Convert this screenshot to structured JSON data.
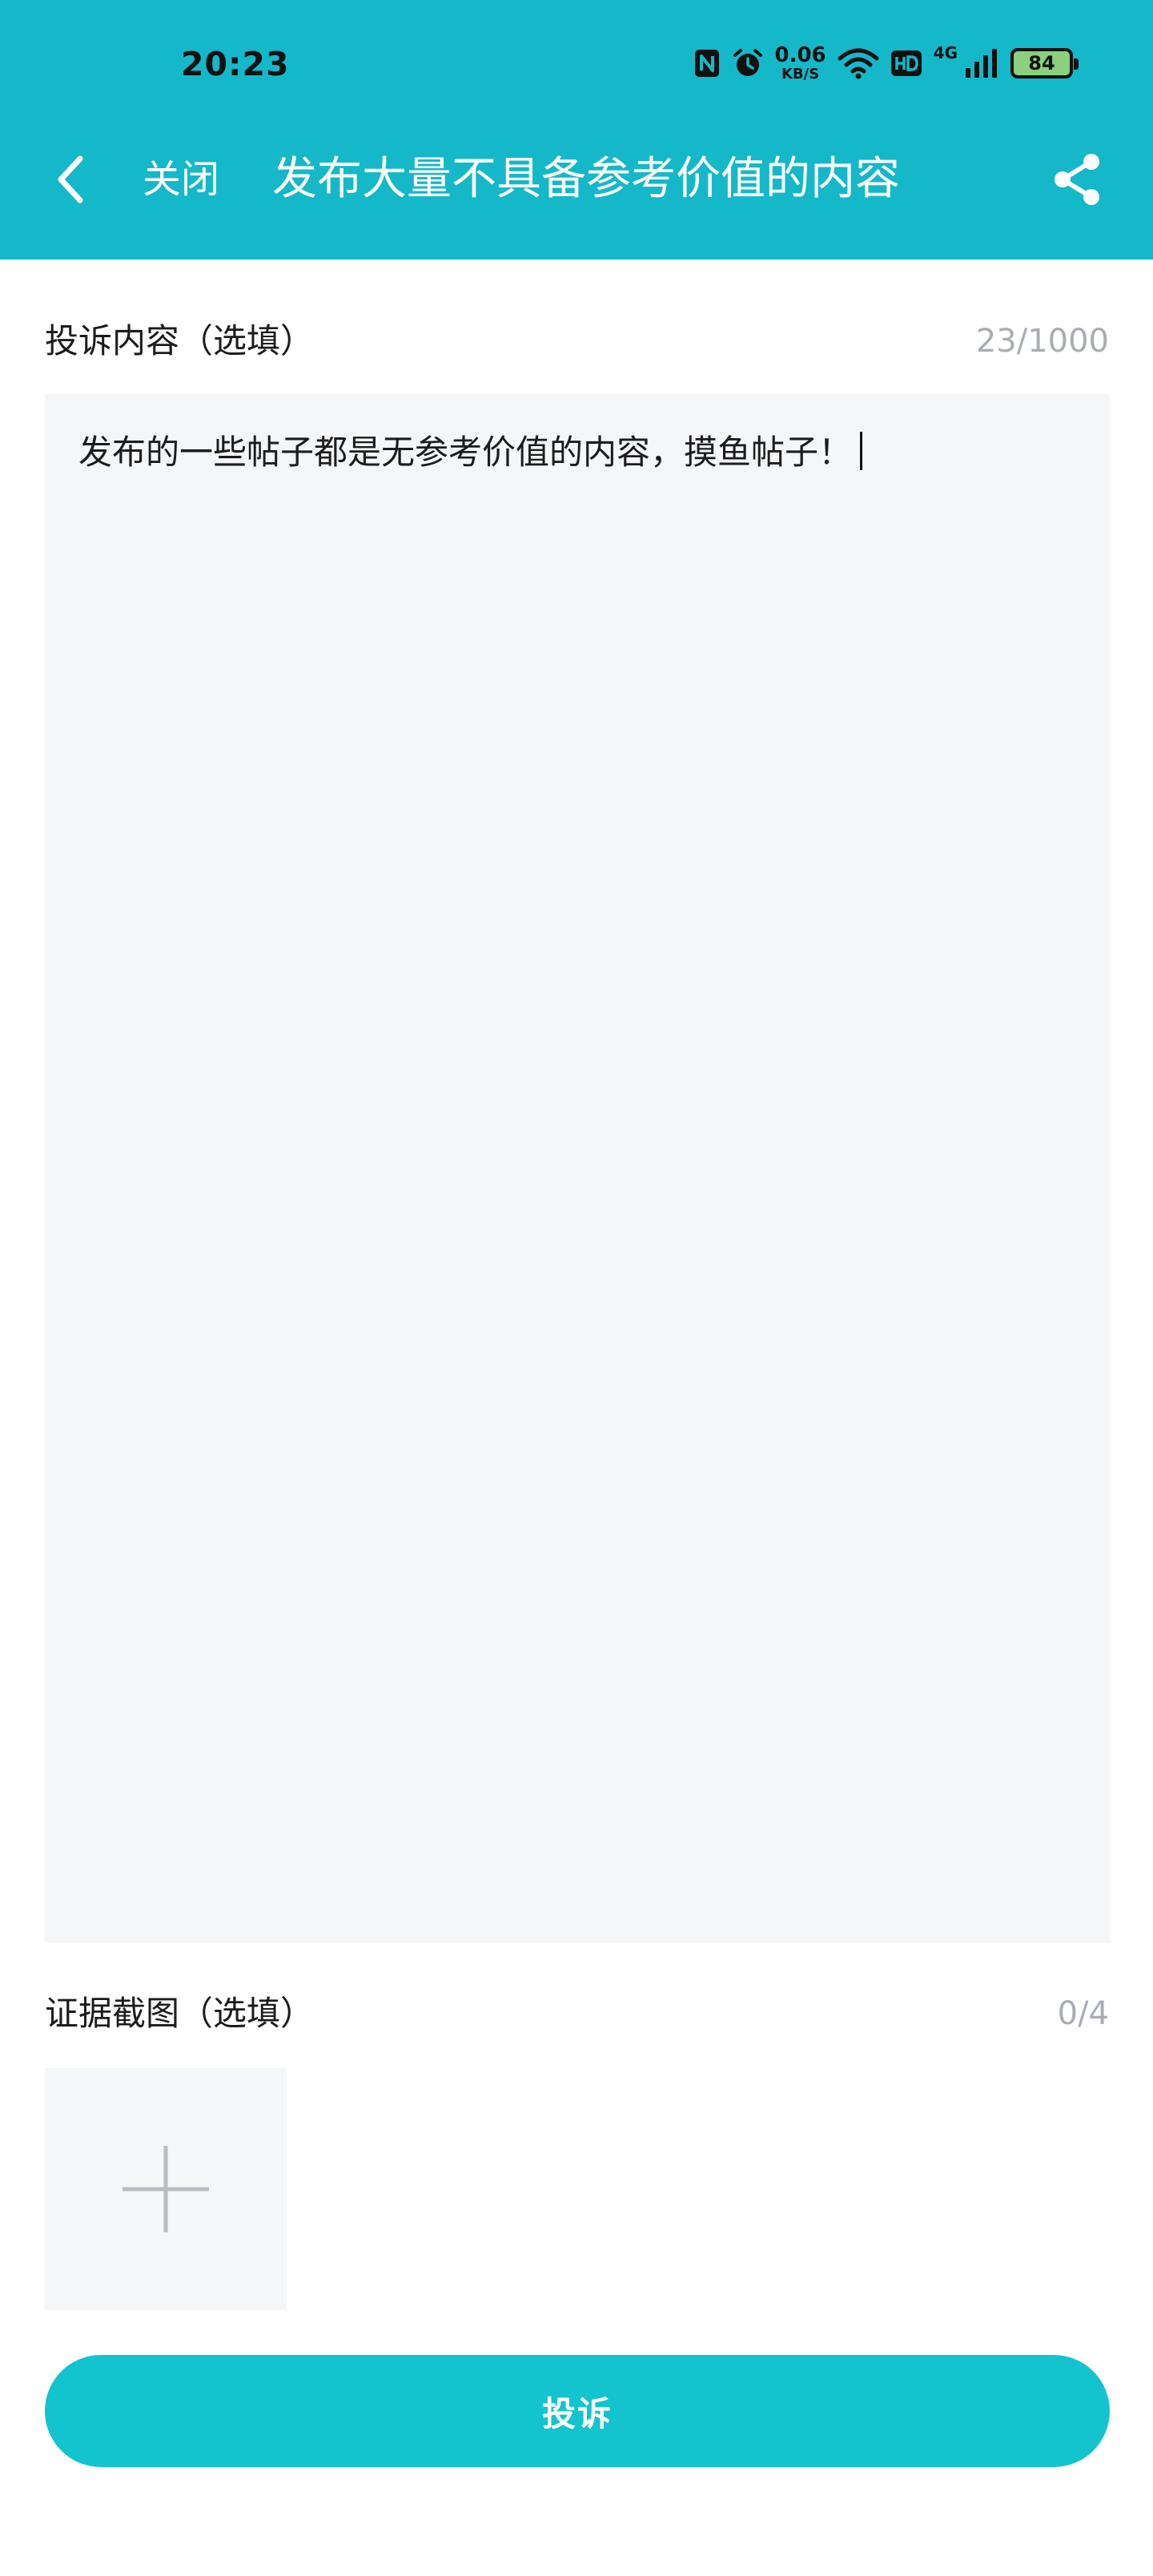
{
  "status_bar": {
    "time": "20:23",
    "net_speed_value": "0.06",
    "net_speed_unit": "KB/S",
    "network_type": "4G",
    "battery_level": "84",
    "icons": [
      "nfc-icon",
      "alarm-icon",
      "wifi-icon",
      "hd-icon",
      "signal-icon",
      "battery-icon"
    ]
  },
  "header": {
    "close_label": "关闭",
    "title": "发布大量不具备参考价值的内容",
    "background_color": "#15b8c8"
  },
  "complaint": {
    "label": "投诉内容（选填）",
    "counter": "23/1000",
    "text": "发布的一些帖子都是无参考价值的内容，摸鱼帖子！"
  },
  "evidence": {
    "label": "证据截图（选填）",
    "counter": "0/4"
  },
  "submit": {
    "label": "投诉",
    "color": "#13c3cd"
  }
}
